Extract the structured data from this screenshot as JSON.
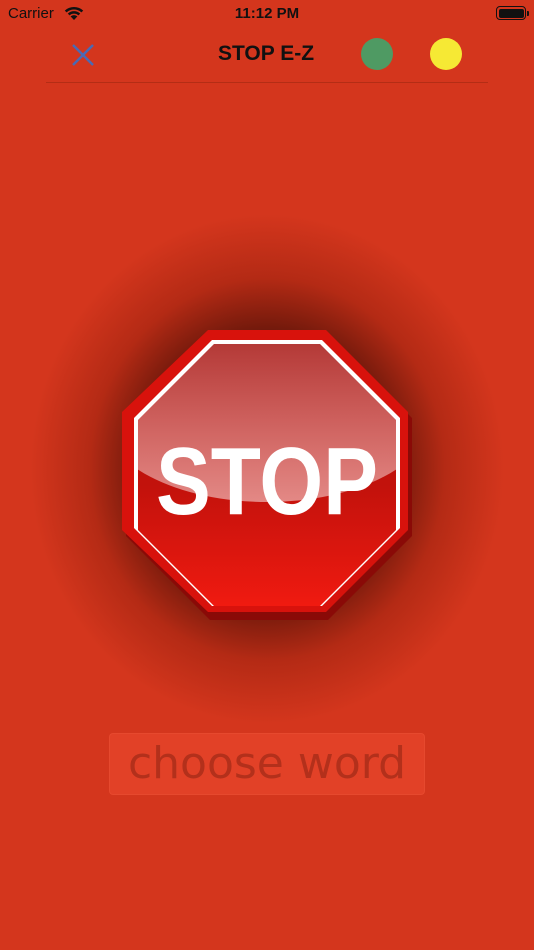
{
  "status_bar": {
    "carrier": "Carrier",
    "time": "11:12 PM",
    "icons": [
      "wifi-icon",
      "battery-icon"
    ]
  },
  "nav": {
    "title": "STOP E-Z",
    "close_icon": "close-icon",
    "buttons": [
      {
        "name": "green-dot",
        "color": "#4f9a63"
      },
      {
        "name": "yellow-dot",
        "color": "#f6e934"
      }
    ]
  },
  "main": {
    "sign_text": "STOP",
    "choose_label": "choose word"
  },
  "colors": {
    "background": "#d4361d",
    "sign_red": "#c8120a",
    "close_icon": "#4a6ab4"
  }
}
